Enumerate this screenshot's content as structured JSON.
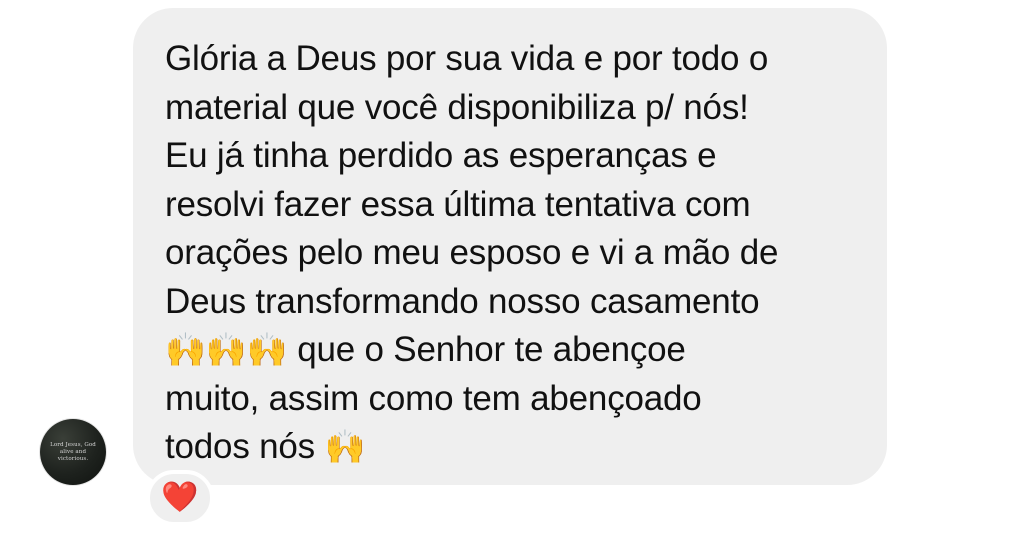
{
  "message": {
    "lines": [
      "Glória a Deus por sua vida e por todo o",
      "material que você disponibiliza p/ nós!",
      "Eu já tinha perdido as esperanças e",
      "resolvi fazer essa última tentativa com",
      "orações pelo meu esposo e vi a mão de",
      "Deus transformando nosso casamento"
    ],
    "emoji_line": {
      "emojis": "🙌🙌🙌",
      "text": " que o Senhor te abençoe"
    },
    "line_8": "muito, assim como tem abençoado",
    "last_line": {
      "text": "todos nós ",
      "emoji": "🙌"
    }
  },
  "avatar": {
    "text": "Lord Jesus, God alive and victorious.",
    "icon": "profile-avatar"
  },
  "reaction": {
    "emoji": "❤️",
    "icon": "heart-icon",
    "color": "#ed1c3a"
  },
  "colors": {
    "bubble_background": "#efefef",
    "text": "#111111",
    "page_background": "#ffffff"
  }
}
